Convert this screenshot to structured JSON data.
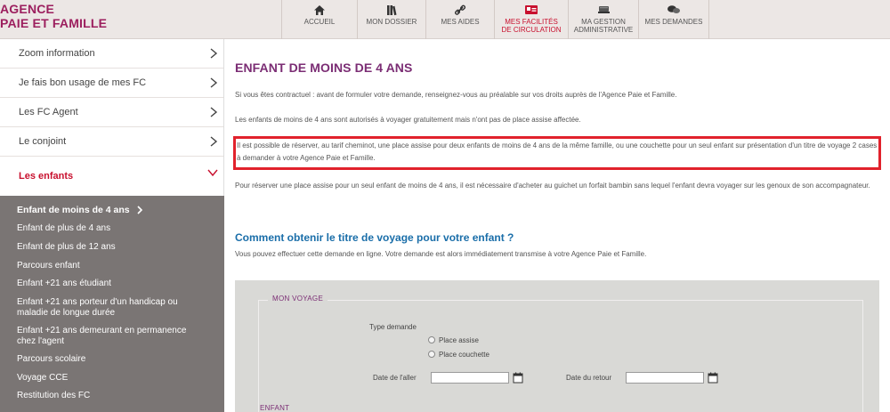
{
  "header": {
    "logo_line1": "AGENCE",
    "logo_line2": "PAIE ET FAMILLE",
    "nav": [
      {
        "label": "ACCUEIL",
        "icon": "home-icon"
      },
      {
        "label": "MON DOSSIER",
        "icon": "folder-icon"
      },
      {
        "label": "MES AIDES",
        "icon": "link-icon"
      },
      {
        "label_line1": "MES FACILITÉS",
        "label_line2": "DE CIRCULATION",
        "icon": "ticket-icon",
        "active": true
      },
      {
        "label_line1": "MA GESTION",
        "label_line2": "ADMINISTRATIVE",
        "icon": "cart-icon"
      },
      {
        "label": "MES DEMANDES",
        "icon": "chat-icon"
      }
    ]
  },
  "sidebar": {
    "items": [
      {
        "label": "Zoom information"
      },
      {
        "label": "Je fais bon usage de mes FC"
      },
      {
        "label": "Les FC Agent"
      },
      {
        "label": "Le conjoint"
      },
      {
        "label": "Les enfants",
        "open": true
      }
    ],
    "submenu": [
      {
        "label": "Enfant de moins de 4 ans",
        "active": true
      },
      {
        "label": "Enfant de plus de 4 ans"
      },
      {
        "label": "Enfant de plus de 12 ans"
      },
      {
        "label": "Parcours enfant"
      },
      {
        "label": "Enfant +21 ans étudiant"
      },
      {
        "label": "Enfant +21 ans porteur d'un handicap ou maladie de longue durée"
      },
      {
        "label": "Enfant +21 ans demeurant en permanence chez l'agent"
      },
      {
        "label": "Parcours scolaire"
      },
      {
        "label": "Voyage CCE"
      },
      {
        "label": "Restitution des FC"
      }
    ]
  },
  "main": {
    "title": "ENFANT DE MOINS DE 4 ANS",
    "paragraphs": [
      "Si vous êtes contractuel : avant de formuler votre demande, renseignez-vous au préalable sur vos droits auprès de l'Agence Paie et Famille.",
      "Les enfants de moins de 4 ans sont autorisés à voyager gratuitement mais n'ont pas de place assise affectée.",
      "Il est possible de réserver, au tarif cheminot, une place assise pour deux enfants de moins de 4 ans de la même famille, ou une couchette pour un seul enfant sur présentation d'un titre de voyage 2 cases à demander à votre Agence Paie et Famille.",
      "Pour réserver une place assise pour un seul enfant de moins de 4 ans, il est nécessaire d'acheter au guichet un forfait bambin sans lequel l'enfant devra voyager sur les genoux de son accompagnateur."
    ],
    "subtitle": "Comment obtenir le titre de voyage pour votre enfant ?",
    "subtitle_text": "Vous pouvez effectuer cette demande en ligne. Votre demande est alors immédiatement transmise à votre Agence Paie et Famille.",
    "form": {
      "legend": "MON VOYAGE",
      "type_label": "Type demande",
      "options": [
        "Place assise",
        "Place couchette"
      ],
      "date_aller_label": "Date de l'aller",
      "date_retour_label": "Date du retour",
      "date_aller_value": "",
      "date_retour_value": "",
      "legend2": "ENFANT"
    }
  },
  "colors": {
    "brand": "#9c1f5e",
    "title": "#7b2d74",
    "link": "#1a6ea9",
    "highlight": "#e1222c"
  }
}
